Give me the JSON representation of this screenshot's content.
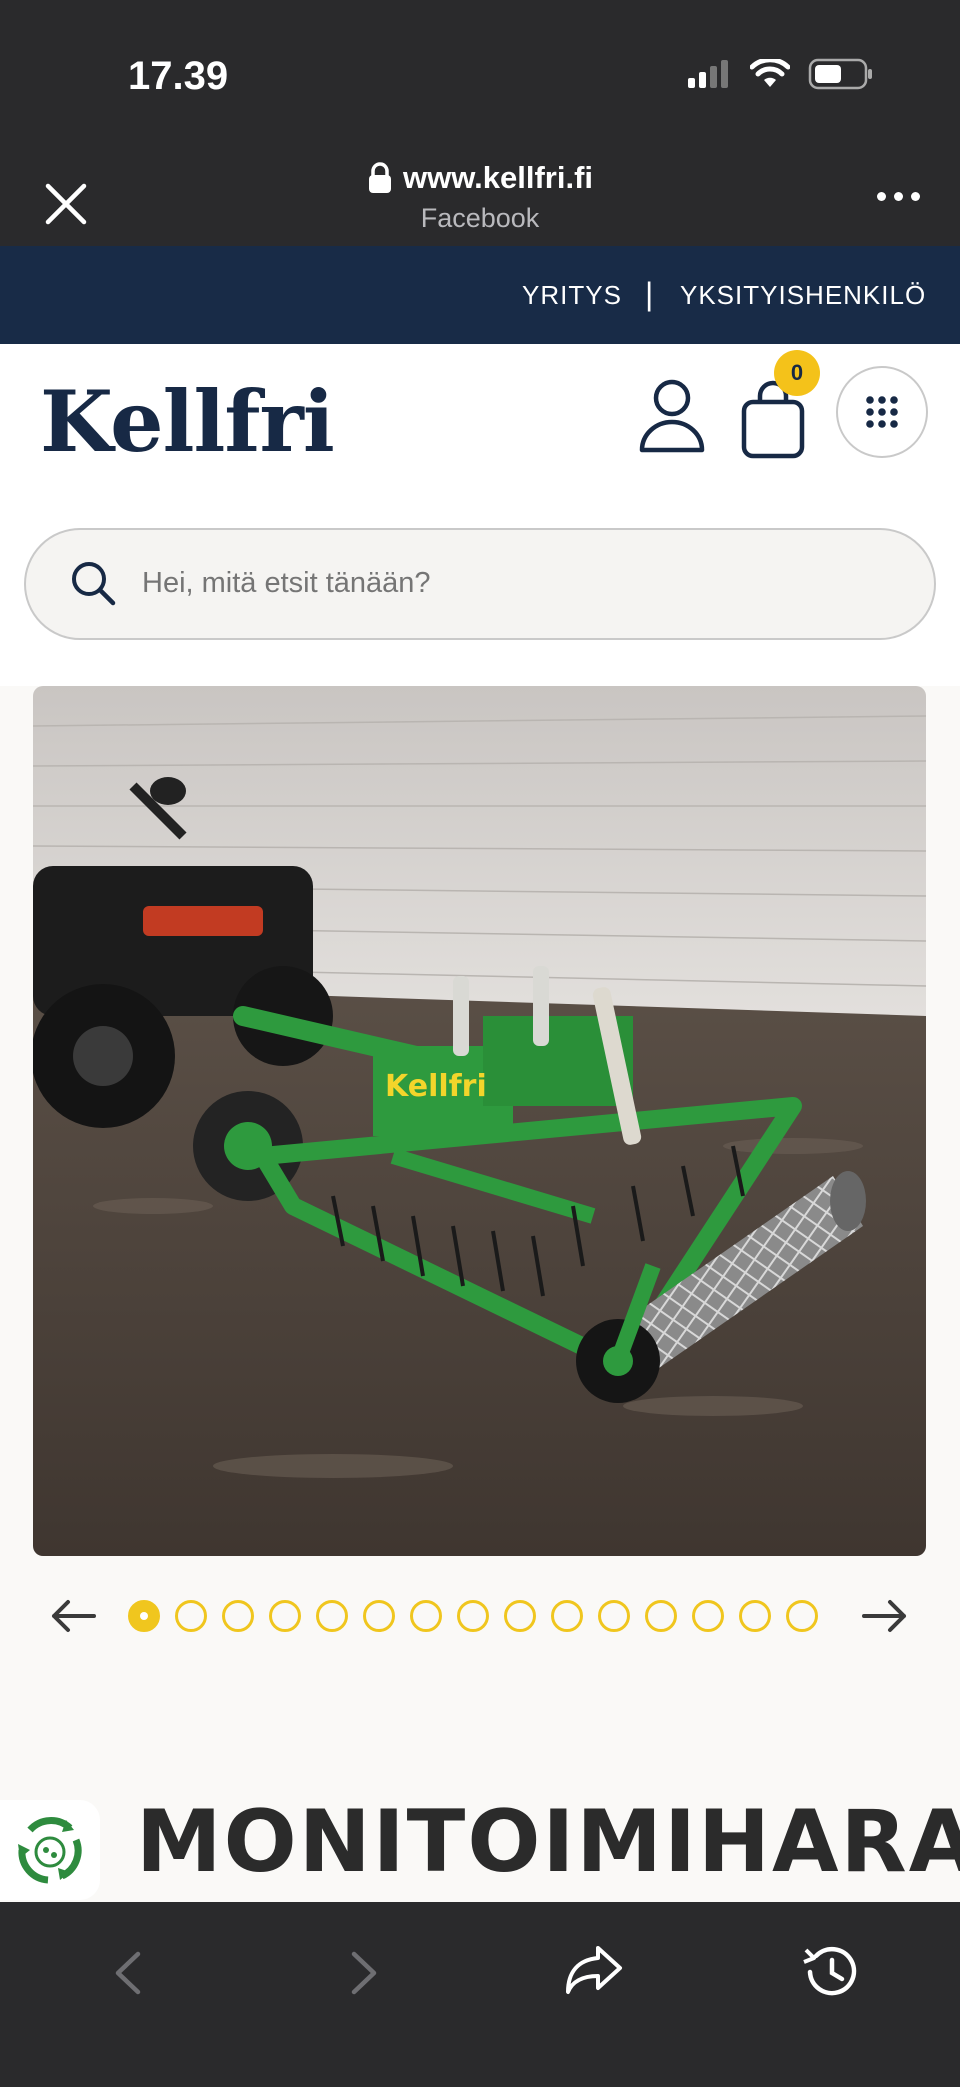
{
  "status_bar": {
    "time": "17.39"
  },
  "browser": {
    "url": "www.kellfri.fi",
    "subtitle": "Facebook"
  },
  "top_nav": {
    "business": "YRITYS",
    "separator": "|",
    "private": "YKSITYISHENKILÖ"
  },
  "header": {
    "logo": "Kellfri",
    "cart_count": "0"
  },
  "search": {
    "placeholder": "Hei, mitä etsit tänään?"
  },
  "carousel": {
    "total_images": 15,
    "active_index": 1
  },
  "product": {
    "title": "MONITOIMIHARA",
    "image_brand_label": "Kellfri"
  },
  "colors": {
    "nav_bg": "#182b47",
    "accent_yellow": "#f4c21a",
    "brand_navy": "#172945",
    "implement_green": "#2e9a3e"
  },
  "bottom_toolbar": {
    "icons": [
      "back-icon",
      "forward-icon",
      "share-icon",
      "history-icon"
    ]
  }
}
